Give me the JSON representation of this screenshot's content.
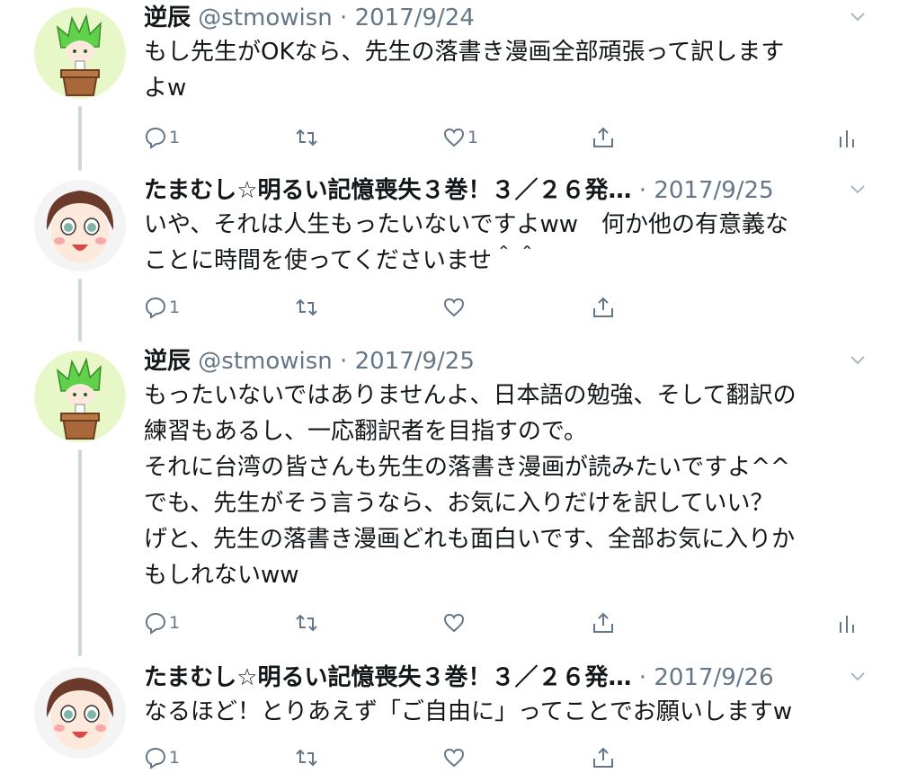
{
  "tweets": [
    {
      "name": "逆辰",
      "handle": "@stmowisn",
      "separator": " · ",
      "date": "2017/9/24",
      "lines": [
        "もし先生がOKなら、先生の落書き漫画全部頑張って訳します",
        "よw"
      ],
      "reply_count": "1",
      "like_count": "1",
      "avatar_icon": "green-hair-plant-pot-avatar-icon",
      "has_analytics": true
    },
    {
      "name": "たまむし☆明るい記憶喪失３巻！３／２６発…",
      "handle": "",
      "separator": " · ",
      "date": "2017/9/25",
      "lines": [
        "いや、それは人生もったいないですよww　何か他の有意義な",
        "ことに時間を使ってくださいませ＾＾"
      ],
      "reply_count": "1",
      "like_count": "",
      "avatar_icon": "brown-hair-girl-avatar-icon",
      "has_analytics": false
    },
    {
      "name": "逆辰",
      "handle": "@stmowisn",
      "separator": " · ",
      "date": "2017/9/25",
      "lines": [
        "もったいないではありませんよ、日本語の勉強、そして翻訳の",
        "練習もあるし、一応翻訳者を目指すので。",
        "それに台湾の皆さんも先生の落書き漫画が読みたいですよ^^",
        "でも、先生がそう言うなら、お気に入りだけを訳していい？",
        "げと、先生の落書き漫画どれも面白いです、全部お気に入りか",
        "もしれないww"
      ],
      "reply_count": "1",
      "like_count": "",
      "avatar_icon": "green-hair-plant-pot-avatar-icon",
      "has_analytics": true
    },
    {
      "name": "たまむし☆明るい記憶喪失３巻！３／２６発…",
      "handle": "",
      "separator": " · ",
      "date": "2017/9/26",
      "lines": [
        "なるほど！とりあえず「ご自由に」ってことでお願いしますw"
      ],
      "reply_count": "1",
      "like_count": "",
      "avatar_icon": "brown-hair-girl-avatar-icon",
      "has_analytics": false
    }
  ],
  "colors": {
    "text": "#14171a",
    "secondary": "#657786",
    "thread_line": "#ccd6dd",
    "green_avatar_bg": "#e8f7c8",
    "girl_avatar_bg": "#f4f4f4"
  }
}
